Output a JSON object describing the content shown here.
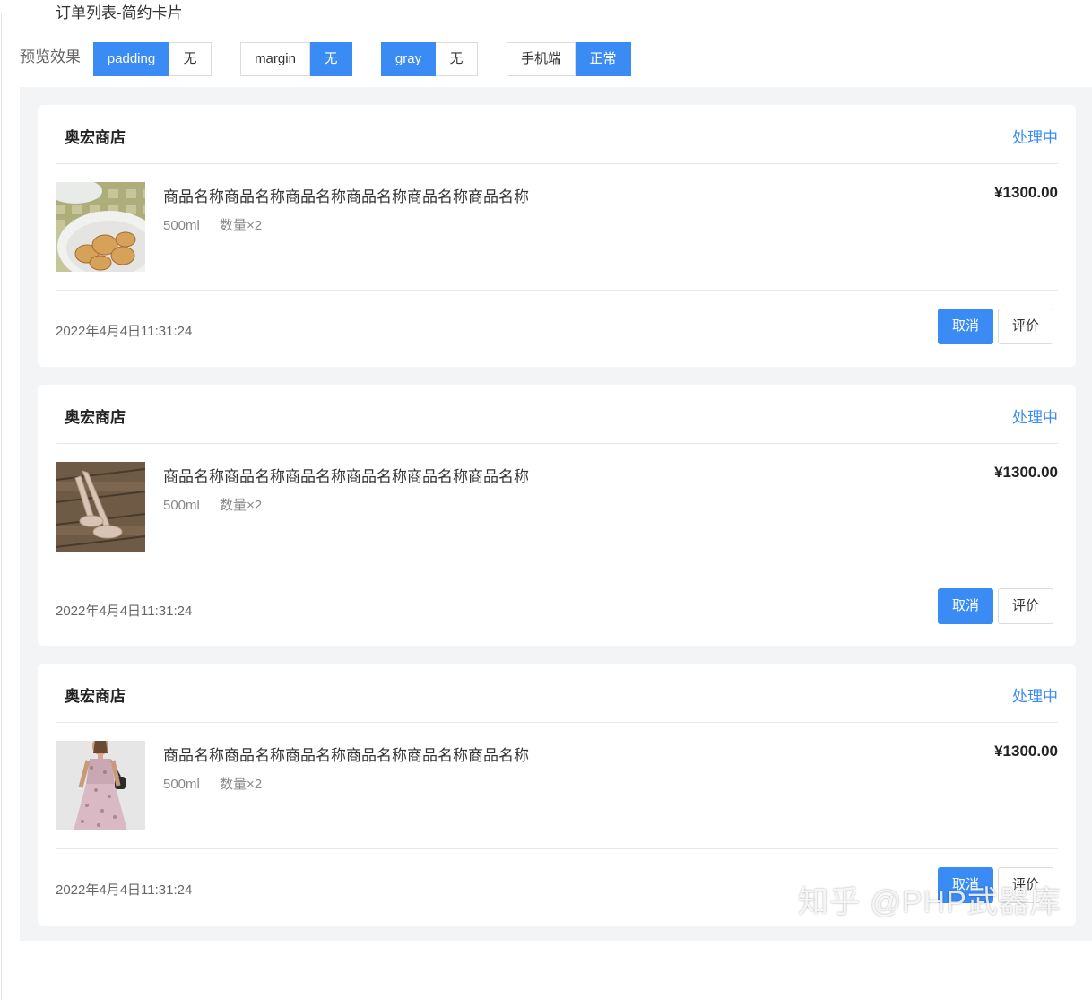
{
  "section_title": "订单列表-简约卡片",
  "preview": {
    "label": "预览效果",
    "groups": [
      {
        "options": [
          "padding",
          "无"
        ],
        "active": 0
      },
      {
        "options": [
          "margin",
          "无"
        ],
        "active": 1
      },
      {
        "options": [
          "gray",
          "无"
        ],
        "active": 0
      },
      {
        "options": [
          "手机端",
          "正常"
        ],
        "active": 1
      }
    ]
  },
  "orders": [
    {
      "store": "奥宏商店",
      "status": "处理中",
      "product_name": "商品名称商品名称商品名称商品名称商品名称商品名称",
      "spec": "500ml",
      "quantity": "数量×2",
      "price": "¥1300.00",
      "time": "2022年4月4日11:31:24",
      "image": "cookies-plate",
      "cancel_label": "取消",
      "rate_label": "评价"
    },
    {
      "store": "奥宏商店",
      "status": "处理中",
      "product_name": "商品名称商品名称商品名称商品名称商品名称商品名称",
      "spec": "500ml",
      "quantity": "数量×2",
      "price": "¥1300.00",
      "time": "2022年4月4日11:31:24",
      "image": "sandals-on-wood",
      "cancel_label": "取消",
      "rate_label": "评价"
    },
    {
      "store": "奥宏商店",
      "status": "处理中",
      "product_name": "商品名称商品名称商品名称商品名称商品名称商品名称",
      "spec": "500ml",
      "quantity": "数量×2",
      "price": "¥1300.00",
      "time": "2022年4月4日11:31:24",
      "image": "woman-in-dress",
      "cancel_label": "取消",
      "rate_label": "评价"
    }
  ],
  "watermark": "知乎 @PHP武器库",
  "colors": {
    "accent": "#3a8bf3",
    "preview_bg": "#f3f4f6",
    "status": "#3a8bf3"
  }
}
